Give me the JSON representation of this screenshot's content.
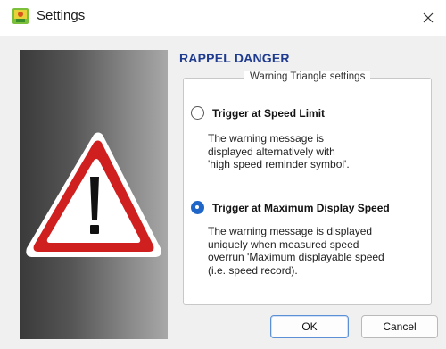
{
  "window": {
    "title": "Settings",
    "close_icon": "close-icon",
    "app_icon": "app-settings-icon"
  },
  "left_panel": {
    "icon": "warning-triangle-icon",
    "colors": {
      "triangle_fill": "#cf1f1f",
      "triangle_border": "#ffffff",
      "exclamation": "#111111"
    }
  },
  "section": {
    "title": "RAPPEL DANGER"
  },
  "group": {
    "legend": "Warning Triangle settings",
    "options": [
      {
        "label": "Trigger at Speed Limit",
        "checked": false,
        "description": "The warning message is\ndisplayed alternatively with\n'high speed reminder symbol'."
      },
      {
        "label": "Trigger at Maximum Display Speed",
        "checked": true,
        "description": "The warning message is displayed\nuniquely when measured speed\noverrun 'Maximum displayable speed\n(i.e. speed record)."
      }
    ]
  },
  "buttons": {
    "ok": "OK",
    "cancel": "Cancel"
  },
  "colors": {
    "accent": "#1f66c8",
    "section_title": "#1f3b8f"
  }
}
